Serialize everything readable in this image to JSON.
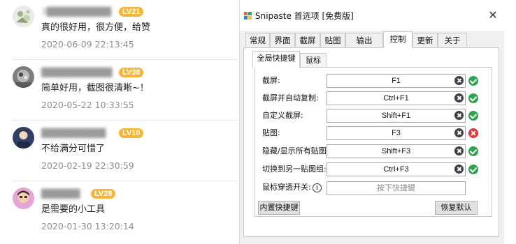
{
  "comments": [
    {
      "username": "3██████████",
      "level": "LV21",
      "text": "真的很好用，很方便，给赞",
      "time": "2020-06-09 22:13:45"
    },
    {
      "username": "███████████",
      "level": "LV38",
      "text": "简单好用，截图很清晰~！",
      "time": "2020-05-22 10:33:55"
    },
    {
      "username": "██████████",
      "level": "LV10",
      "text": "不给满分可惜了",
      "time": "2020-02-19 22:30:59"
    },
    {
      "username": "██████",
      "level": "LV28",
      "text": "是需要的小工具",
      "time": "2020-01-30 13:20:14"
    }
  ],
  "dialog": {
    "title": "Snipaste 首选项 [免费版]",
    "close": "✕",
    "tabs": [
      "常规",
      "界面",
      "截屏",
      "贴图",
      "输出",
      "控制",
      "更新",
      "关于"
    ],
    "active_tab": "控制",
    "subtabs": [
      "全局快捷键",
      "鼠标"
    ],
    "active_subtab": "全局快捷键",
    "shortcuts": [
      {
        "label": "截屏:",
        "key": "F1",
        "status": "ok"
      },
      {
        "label": "截屏并自动复制:",
        "key": "Ctrl+F1",
        "status": "ok"
      },
      {
        "label": "自定义截屏:",
        "key": "Shift+F1",
        "status": "ok"
      },
      {
        "label": "贴图:",
        "key": "F3",
        "status": "conflict"
      },
      {
        "label": "隐藏/显示所有贴图:",
        "key": "Shift+F3",
        "status": "ok"
      },
      {
        "label": "切换到另一贴图组:",
        "key": "Ctrl+F3",
        "status": "ok"
      }
    ],
    "mouse_passthrough": {
      "label": "鼠标穿透开关:",
      "placeholder": "按下快捷键",
      "info": "i"
    },
    "buttons": {
      "builtin": "内置快捷键",
      "restore": "恢复默认"
    },
    "colors": {
      "level_badge": "#f7b53a",
      "ok": "#2ea44f",
      "conflict": "#dd3b3b"
    }
  }
}
